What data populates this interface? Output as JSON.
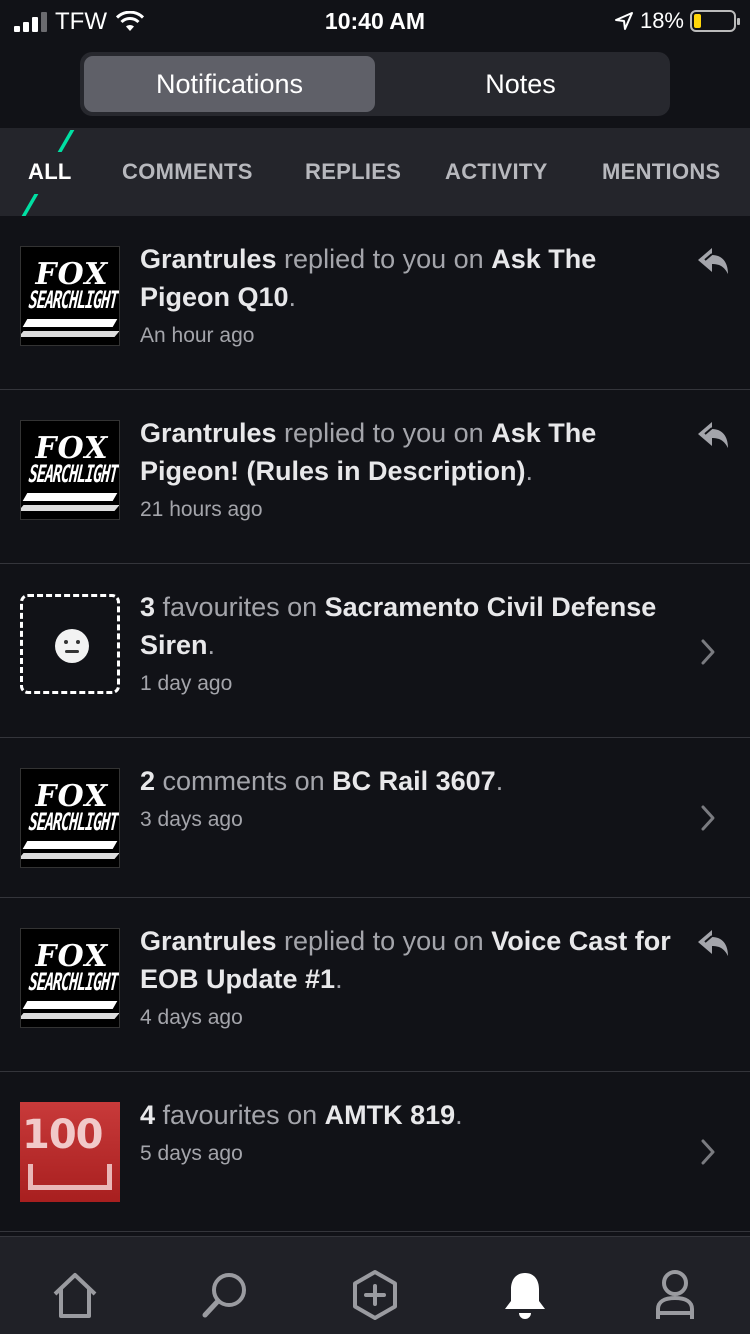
{
  "status_bar": {
    "carrier": "TFW",
    "time": "10:40 AM",
    "battery_percent": "18%",
    "battery_level": 0.18,
    "battery_color": "#ffd60a"
  },
  "segmented": {
    "notifications_label": "Notifications",
    "notes_label": "Notes",
    "selected": "Notifications"
  },
  "tabs": [
    {
      "label": "ALL",
      "active": true
    },
    {
      "label": "COMMENTS",
      "active": false
    },
    {
      "label": "REPLIES",
      "active": false
    },
    {
      "label": "ACTIVITY",
      "active": false
    },
    {
      "label": "MENTIONS",
      "active": false
    }
  ],
  "accent_color": "#00e0a3",
  "notifications": [
    {
      "thumb": "fox-searchlight",
      "actor": "Grantrules",
      "verb": " replied to you on ",
      "target": "Ask The Pigeon Q10",
      "end": ".",
      "time": "An hour ago",
      "action_icon": "reply-icon"
    },
    {
      "thumb": "fox-searchlight",
      "actor": "Grantrules",
      "verb": " replied to you on ",
      "target": "Ask The Pigeon! (Rules in Description)",
      "end": ".",
      "time": "21 hours ago",
      "action_icon": "reply-icon"
    },
    {
      "thumb": "smiley-dashed",
      "actor": "3",
      "verb": " favourites on ",
      "target": "Sacramento Civil Defense Siren",
      "end": ".",
      "time": "1 day ago",
      "action_icon": "chevron-right-icon"
    },
    {
      "thumb": "fox-searchlight",
      "actor": "2",
      "verb": " comments on ",
      "target": "BC Rail 3607",
      "end": ".",
      "time": "3 days ago",
      "action_icon": "chevron-right-icon"
    },
    {
      "thumb": "fox-searchlight",
      "actor": "Grantrules",
      "verb": " replied to you on ",
      "target": "Voice Cast for EOB Update #1",
      "end": ".",
      "time": "4 days ago",
      "action_icon": "reply-icon"
    },
    {
      "thumb": "rail-100",
      "actor": "4",
      "verb": " favourites on ",
      "target": "AMTK 819",
      "end": ".",
      "time": "5 days ago",
      "action_icon": "chevron-right-icon"
    }
  ],
  "thumb_text": {
    "fox_top": "FOX",
    "fox_mid": "SEARCHLIGHT",
    "rail_num": "100"
  },
  "bottom_nav": [
    {
      "name": "home",
      "icon": "home-icon",
      "active": false
    },
    {
      "name": "search",
      "icon": "search-icon",
      "active": false
    },
    {
      "name": "create",
      "icon": "add-hexagon-icon",
      "active": false
    },
    {
      "name": "notifications",
      "icon": "bell-icon",
      "active": true
    },
    {
      "name": "profile",
      "icon": "profile-icon",
      "active": false
    }
  ]
}
